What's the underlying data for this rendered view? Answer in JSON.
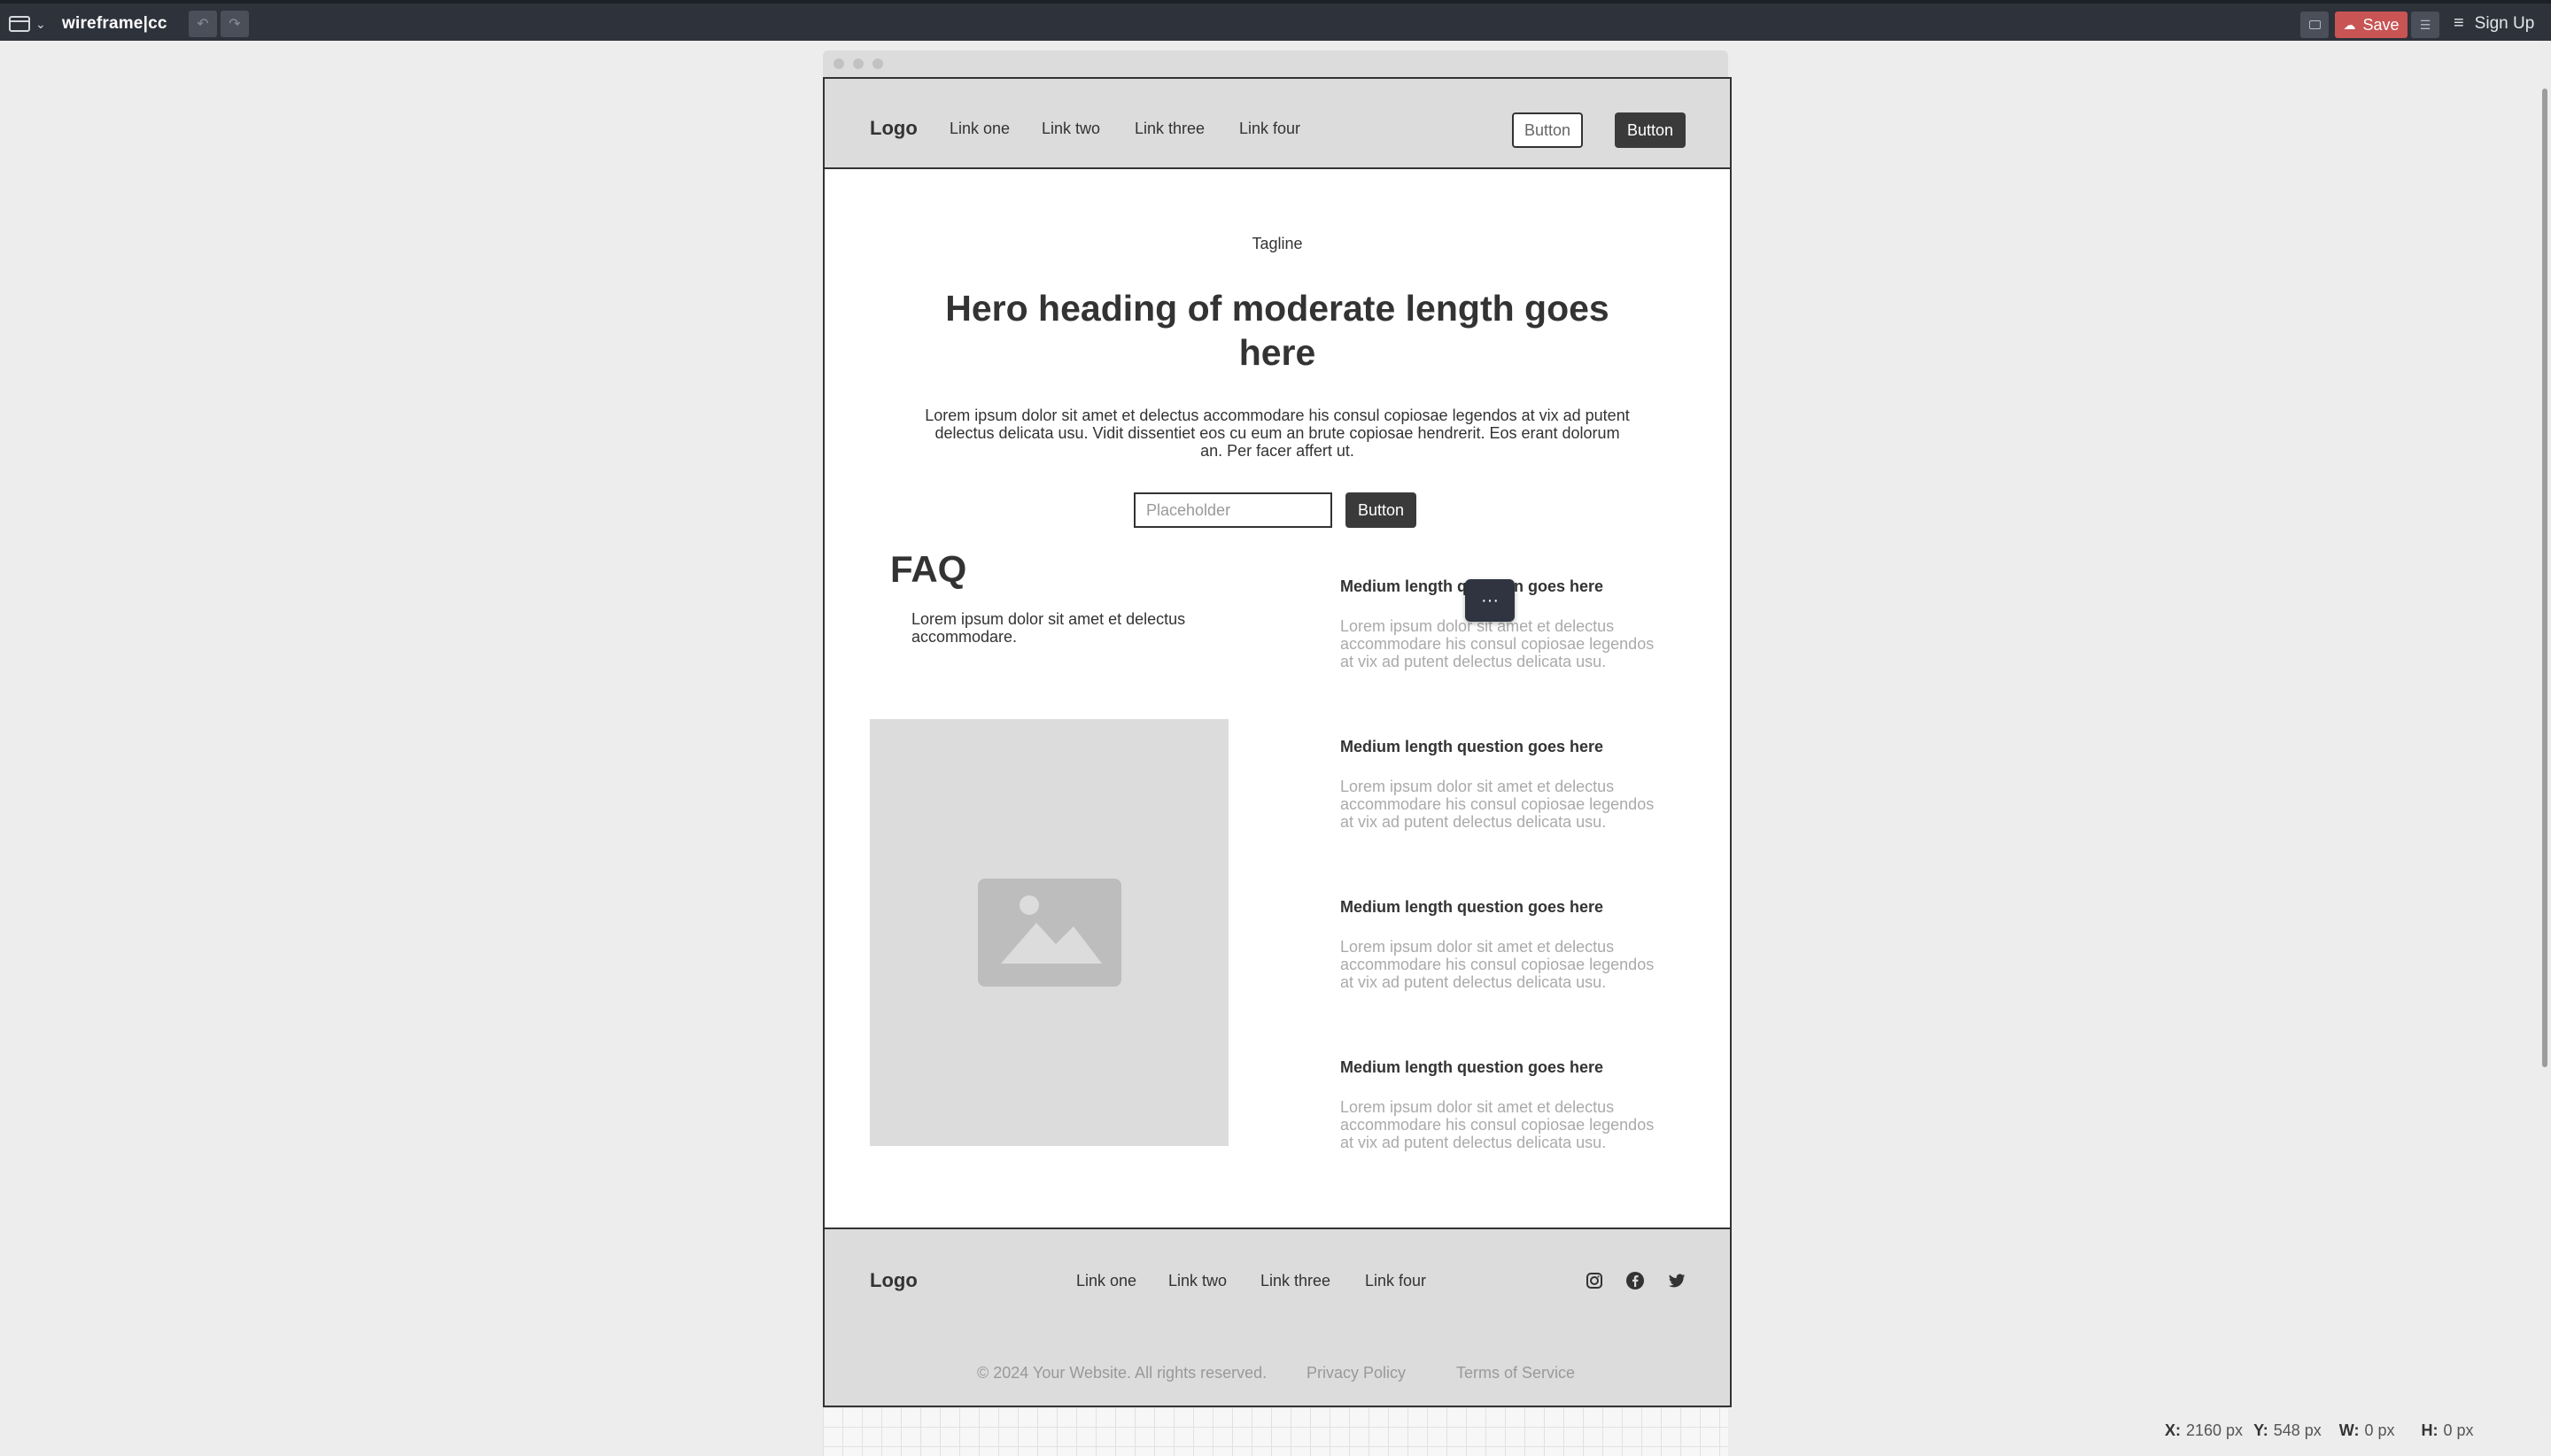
{
  "app": {
    "brand": "wireframe|cc",
    "save_label": "Save",
    "signup_label": "Sign Up"
  },
  "site": {
    "logo": "Logo",
    "nav": [
      "Link one",
      "Link two",
      "Link three",
      "Link four"
    ],
    "header_buttons": [
      "Button",
      "Button"
    ],
    "tagline": "Tagline",
    "hero_heading": "Hero heading of moderate length goes here",
    "hero_body": "Lorem ipsum dolor sit amet et delectus accommodare his consul copiosae legendos at vix ad putent delectus delicata usu. Vidit dissentiet eos cu eum an brute copiosae hendrerit. Eos erant dolorum an. Per facer affert ut.",
    "input_placeholder": "Placeholder",
    "cta_button": "Button",
    "faq_title": "FAQ",
    "faq_subtitle": "Lorem ipsum dolor sit amet et delectus accommodare.",
    "faq": [
      {
        "q": "Medium length question goes here",
        "a": "Lorem ipsum dolor sit amet et delectus accommodare his consul copiosae legendos at vix ad putent delectus delicata usu."
      },
      {
        "q": "Medium length question goes here",
        "a": "Lorem ipsum dolor sit amet et delectus accommodare his consul copiosae legendos at vix ad putent delectus delicata usu."
      },
      {
        "q": "Medium length question goes here",
        "a": "Lorem ipsum dolor sit amet et delectus accommodare his consul copiosae legendos at vix ad putent delectus delicata usu."
      },
      {
        "q": "Medium length question goes here",
        "a": "Lorem ipsum dolor sit amet et delectus accommodare his consul copiosae legendos at vix ad putent delectus delicata usu."
      }
    ],
    "context_menu_label": "···",
    "footer": {
      "logo": "Logo",
      "nav": [
        "Link one",
        "Link two",
        "Link three",
        "Link four"
      ],
      "copyright": "© 2024 Your Website. All rights reserved.",
      "privacy": "Privacy Policy",
      "terms": "Terms of Service",
      "social_icons": [
        "instagram-icon",
        "facebook-icon",
        "twitter-icon"
      ]
    }
  },
  "status": {
    "x_label": "X:",
    "x_value": "2160 px",
    "y_label": "Y:",
    "y_value": "548 px",
    "w_label": "W:",
    "w_value": "0 px",
    "h_label": "H:",
    "h_value": "0 px"
  },
  "colors": {
    "toolbar": "#2e323b",
    "save": "#c85454",
    "wireframe_gray": "#dcdcdc",
    "dark_button": "#3a3a3a"
  }
}
